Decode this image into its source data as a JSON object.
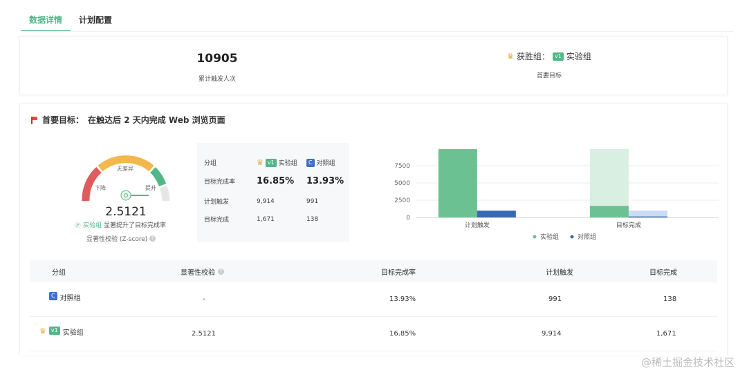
{
  "tabs": [
    {
      "label": "数据详情",
      "active": true
    },
    {
      "label": "计划配置",
      "active": false
    }
  ],
  "summary": {
    "total_value": "10905",
    "total_label": "累计触发人次",
    "winner_prefix": "获胜组：",
    "winner_badge": "v1",
    "winner_group": "实验组",
    "winner_label": "首要目标"
  },
  "goal": {
    "prefix": "首要目标：",
    "text": "在触达后 2 天内完成 Web 浏览页面"
  },
  "gauge": {
    "label_none": "无差异",
    "label_down": "下降",
    "label_up": "提升",
    "value": "2.5121",
    "msg_group": "实验组",
    "msg_text": "显著提升了目标完成率",
    "footer": "显著性校验 (Z-score)",
    "colors": {
      "low": "#e05c5c",
      "mid": "#f2b84b",
      "high": "#52b788",
      "rest": "#e6e6e6"
    }
  },
  "comparison": {
    "header_group": "分组",
    "exp_badge": "v1",
    "exp_label": "实验组",
    "ctrl_badge": "C",
    "ctrl_label": "对照组",
    "rows": [
      {
        "label": "目标完成率",
        "exp": "16.85%",
        "ctrl": "13.93%"
      },
      {
        "label": "计划触发",
        "exp": "9,914",
        "ctrl": "991"
      },
      {
        "label": "目标完成",
        "exp": "1,671",
        "ctrl": "138"
      }
    ]
  },
  "chart_data": {
    "type": "bar",
    "categories": [
      "计划触发",
      "目标完成"
    ],
    "series": [
      {
        "name": "实验组",
        "values": [
          9914,
          1671
        ],
        "color": "#6cc192"
      },
      {
        "name": "对照组",
        "values": [
          991,
          138
        ],
        "color": "#3669b3"
      }
    ],
    "ylim": [
      0,
      10000
    ],
    "yticks": [
      "0",
      "2500",
      "5000",
      "7500"
    ],
    "ytick_values": [
      0,
      2500,
      5000,
      7500
    ],
    "legend_position": "bottom"
  },
  "table": {
    "headers": [
      "分组",
      "显著性校验",
      "目标完成率",
      "计划触发",
      "目标完成"
    ],
    "rows": [
      {
        "badge": "C",
        "group": "对照组",
        "sig": "-",
        "rate": "13.93%",
        "triggered": "991",
        "completed": "138",
        "winner": false
      },
      {
        "badge": "v1",
        "group": "实验组",
        "sig": "2.5121",
        "rate": "16.85%",
        "triggered": "9,914",
        "completed": "1,671",
        "winner": true
      }
    ]
  },
  "watermark": "@稀土掘金技术社区"
}
